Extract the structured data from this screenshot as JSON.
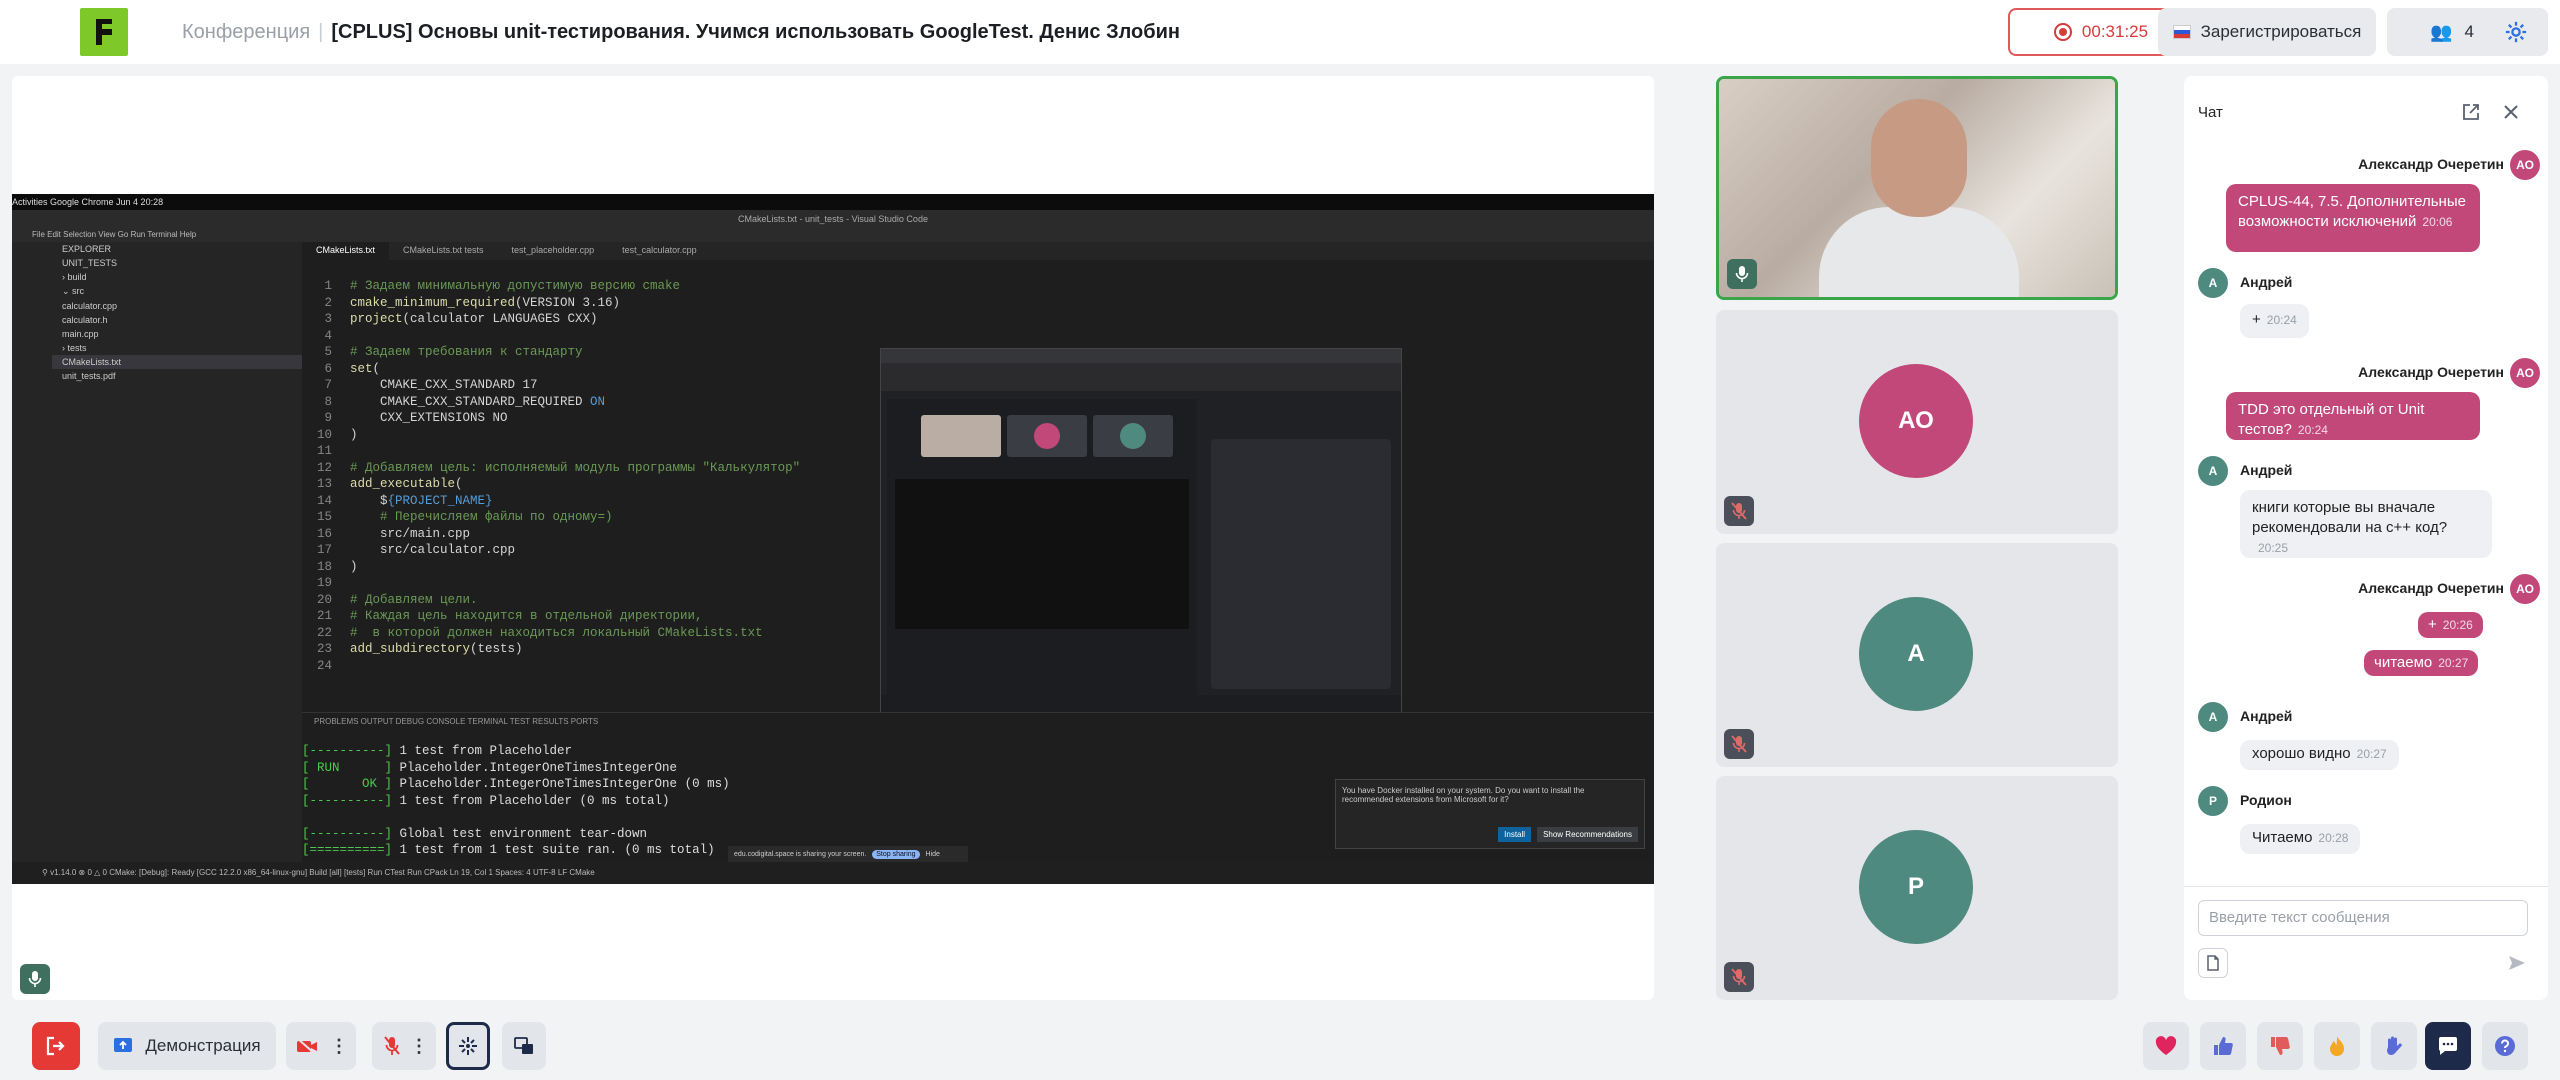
{
  "header": {
    "conference_label": "Конференция",
    "separator": "|",
    "title": "[CPLUS] Основы unit-тестирования. Учимся использовать GoogleTest. Денис Злобин",
    "record_time": "00:31:25",
    "register_label": "Зарегистрироваться",
    "participants_count": "4"
  },
  "screen_share": {
    "gnome_bar": "Activities    Google Chrome                                                                                                                                Jun 4  20:28",
    "vscode_title": "CMakeLists.txt - unit_tests - Visual Studio Code",
    "vscode_menu": "File   Edit   Selection   View   Go   Run   Terminal   Help",
    "explorer": [
      "EXPLORER",
      "UNIT_TESTS",
      "› build",
      "⌄ src",
      "   calculator.cpp",
      "   calculator.h",
      "   main.cpp",
      "› tests",
      "   CMakeLists.txt",
      "   unit_tests.pdf"
    ],
    "tabs": [
      "CMakeLists.txt",
      "CMakeLists.txt tests",
      "test_placeholder.cpp",
      "test_calculator.cpp"
    ],
    "panel_tabs": "PROBLEMS    OUTPUT    DEBUG CONSOLE    TERMINAL    TEST RESULTS    PORTS",
    "docker_notice": "You have Docker installed on your system. Do you want to install the recommended extensions from Microsoft for it?",
    "docker_install": "Install",
    "docker_show": "Show Recommendations",
    "share_notice": "edu.codigital.space is sharing your screen.",
    "share_stop": "Stop sharing",
    "share_hide": "Hide",
    "statusbar": "⚲ v1.14.0   ⊗ 0  △ 0    CMake: [Debug]: Ready    [GCC 12.2.0 x86_64-linux-gnu]    Build    [all]    [tests]    Run CTest    Run CPack                                                              Ln 19, Col 1   Spaces: 4   UTF-8   LF   CMake"
  },
  "tiles": {
    "t2_initials": "АО",
    "t3_initials": "А",
    "t4_initials": "Р"
  },
  "chat": {
    "title": "Чат",
    "messages": [
      {
        "author": "Александр Очеретин",
        "initials": "АО",
        "text": "CPLUS-44,  7.5. Дополнительные возможности исключений",
        "time": "20:06",
        "own": true
      },
      {
        "author": "Андрей",
        "initials": "А",
        "text": "+",
        "time": "20:24",
        "own": false
      },
      {
        "author": "Александр Очеретин",
        "initials": "АО",
        "text": "TDD это отдельный от Unit тестов?",
        "time": "20:24",
        "own": true
      },
      {
        "author": "Андрей",
        "initials": "А",
        "text": "книги которые вы вначале рекомендовали на с++ код?",
        "time": "20:25",
        "own": false
      },
      {
        "author": "Александр Очеретин",
        "initials": "АО",
        "text": "+",
        "time": "20:26",
        "own": true
      },
      {
        "author": "",
        "initials": "",
        "text": "читаемо",
        "time": "20:27",
        "own": true
      },
      {
        "author": "Андрей",
        "initials": "А",
        "text": "хорошо видно",
        "time": "20:27",
        "own": false
      },
      {
        "author": "Родион",
        "initials": "Р",
        "text": "Читаемо",
        "time": "20:28",
        "own": false
      }
    ],
    "input_placeholder": "Введите текст сообщения"
  },
  "bottom": {
    "demo_label": "Демонстрация"
  },
  "colors": {
    "accent": "#c2487a",
    "teal": "#4f8a80",
    "record": "#d63b3b",
    "logo": "#7ec82a"
  }
}
